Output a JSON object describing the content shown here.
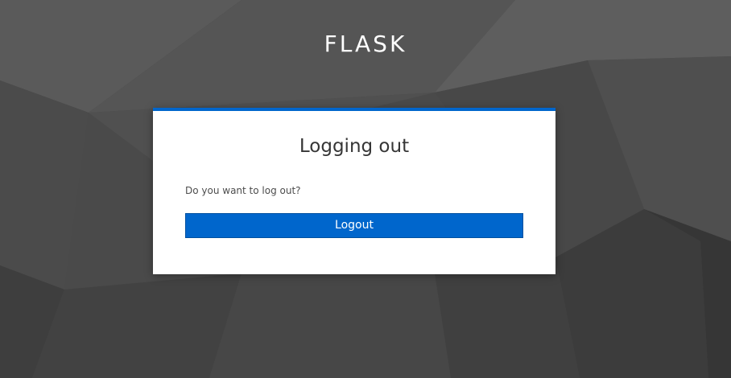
{
  "header": {
    "realm_name": "FLASK"
  },
  "logout_card": {
    "title": "Logging out",
    "prompt": "Do you want to log out?",
    "logout_button_label": "Logout"
  },
  "colors": {
    "accent": "#0066cc",
    "background": "#4a4a4a",
    "card": "#ffffff"
  }
}
